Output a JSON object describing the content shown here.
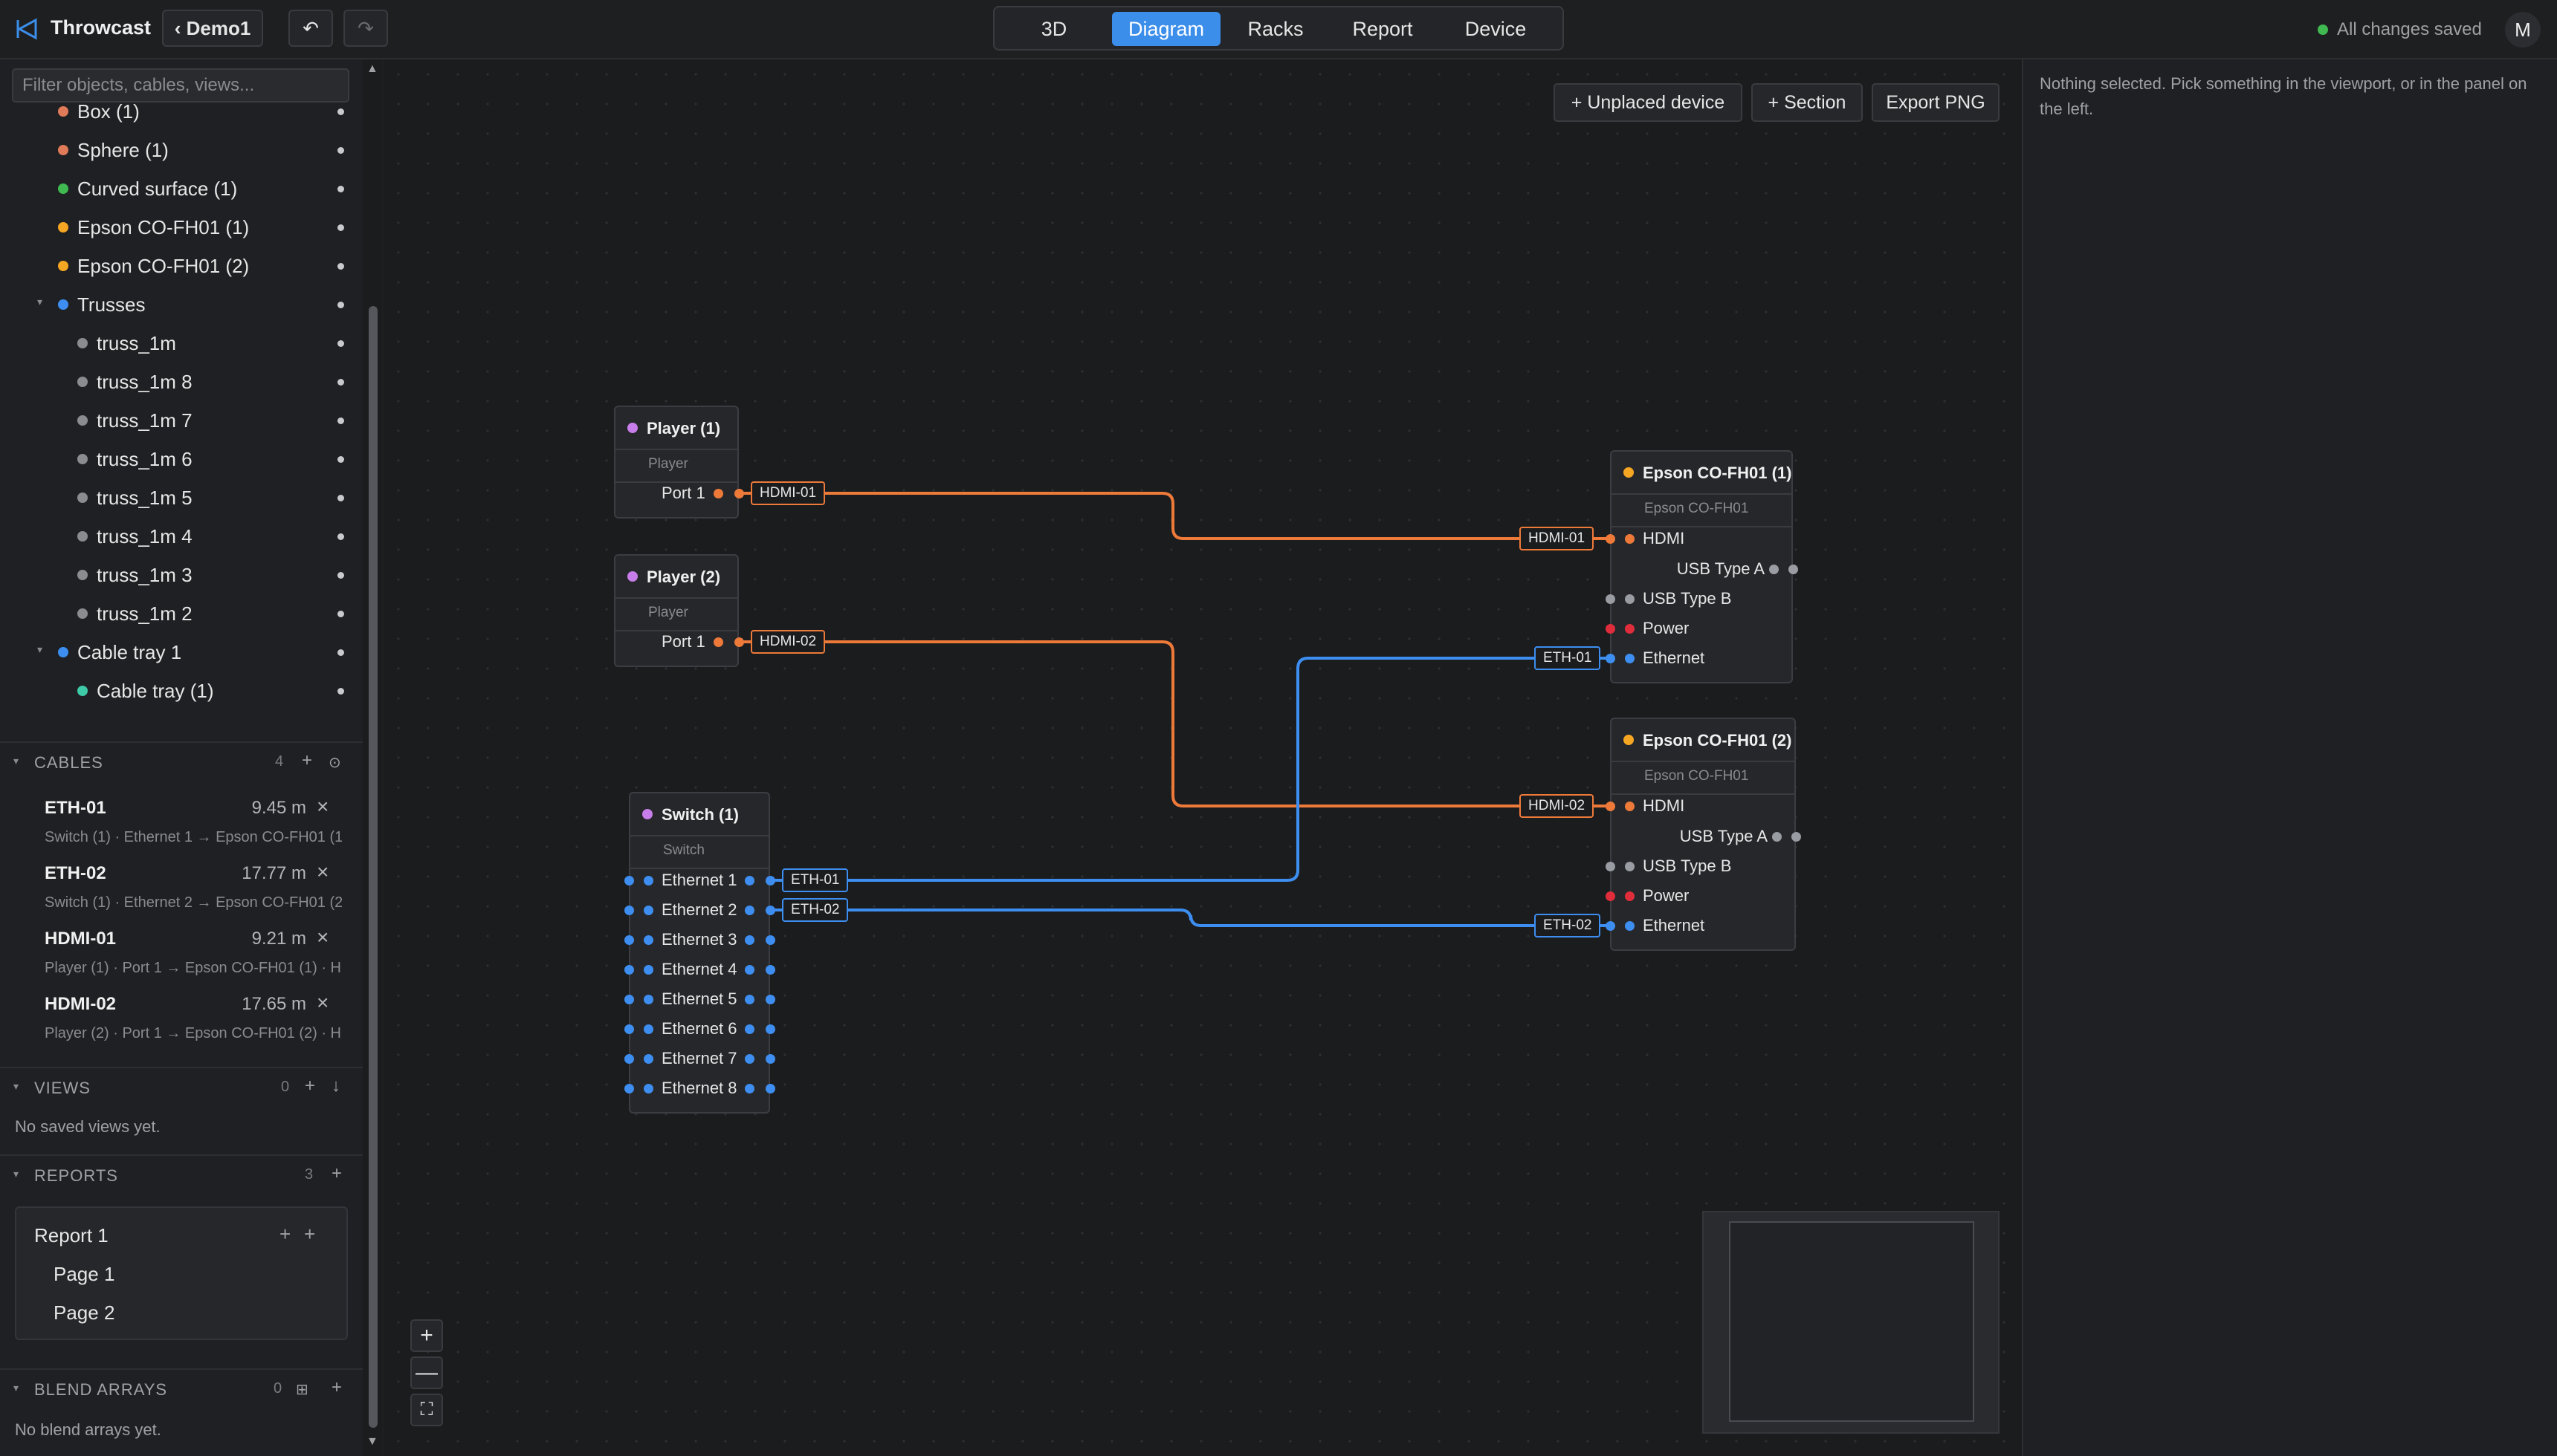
{
  "app": {
    "name": "Throwcast",
    "project_button": "‹ Demo1",
    "undo": "↶",
    "redo": "↷",
    "tabs": [
      {
        "label": "3D",
        "active": false
      },
      {
        "label": "Diagram",
        "active": true
      },
      {
        "label": "Racks",
        "active": false
      },
      {
        "label": "Report",
        "active": false
      },
      {
        "label": "Device",
        "active": false
      }
    ],
    "save_status": "All changes saved",
    "avatar_initial": "M",
    "colors": {
      "accent": "#3b8eea",
      "saved": "#3fb950",
      "hdmi": "#ee7a3a",
      "ethernet": "#3d8ef0",
      "power": "#e02d3c",
      "usb": "#9a9ca3"
    }
  },
  "sidebar": {
    "filter_placeholder": "Filter objects, cables, views...",
    "tree": [
      {
        "label": "Box (1)",
        "color": "#e07b5a",
        "indent": 1,
        "chevron": ""
      },
      {
        "label": "Sphere (1)",
        "color": "#e07b5a",
        "indent": 1,
        "chevron": ""
      },
      {
        "label": "Curved surface (1)",
        "color": "#3fb950",
        "indent": 1,
        "chevron": ""
      },
      {
        "label": "Epson CO-FH01 (1)",
        "color": "#f5a623",
        "indent": 1,
        "chevron": ""
      },
      {
        "label": "Epson CO-FH01 (2)",
        "color": "#f5a623",
        "indent": 1,
        "chevron": ""
      },
      {
        "label": "Trusses",
        "color": "#3d8ef0",
        "indent": 1,
        "chevron": "▾"
      },
      {
        "label": "truss_1m",
        "color": "#8b8c90",
        "indent": 2,
        "chevron": ""
      },
      {
        "label": "truss_1m 8",
        "color": "#8b8c90",
        "indent": 2,
        "chevron": ""
      },
      {
        "label": "truss_1m 7",
        "color": "#8b8c90",
        "indent": 2,
        "chevron": ""
      },
      {
        "label": "truss_1m 6",
        "color": "#8b8c90",
        "indent": 2,
        "chevron": ""
      },
      {
        "label": "truss_1m 5",
        "color": "#8b8c90",
        "indent": 2,
        "chevron": ""
      },
      {
        "label": "truss_1m 4",
        "color": "#8b8c90",
        "indent": 2,
        "chevron": ""
      },
      {
        "label": "truss_1m 3",
        "color": "#8b8c90",
        "indent": 2,
        "chevron": ""
      },
      {
        "label": "truss_1m 2",
        "color": "#8b8c90",
        "indent": 2,
        "chevron": ""
      },
      {
        "label": "Cable tray 1",
        "color": "#3d8ef0",
        "indent": 1,
        "chevron": "▾"
      },
      {
        "label": "Cable tray (1)",
        "color": "#3ec9a7",
        "indent": 2,
        "chevron": ""
      }
    ],
    "cables_section": {
      "title": "CABLES",
      "count": "4",
      "add": "+",
      "extra": "⊙"
    },
    "cables": [
      {
        "name": "ETH-01",
        "length": "9.45 m",
        "description": "Switch (1) · Ethernet 1 → Epson CO-FH01 (1..."
      },
      {
        "name": "ETH-02",
        "length": "17.77 m",
        "description": "Switch (1) · Ethernet 2 → Epson CO-FH01 (2..."
      },
      {
        "name": "HDMI-01",
        "length": "9.21 m",
        "description": "Player (1) · Port 1 → Epson CO-FH01 (1) · H..."
      },
      {
        "name": "HDMI-02",
        "length": "17.65 m",
        "description": "Player (2) · Port 1 → Epson CO-FH01 (2) · H..."
      }
    ],
    "views_section": {
      "title": "VIEWS",
      "count": "0",
      "add": "+",
      "extra": "↓",
      "empty": "No saved views yet."
    },
    "reports_section": {
      "title": "REPORTS",
      "count": "3",
      "add": "+"
    },
    "report": {
      "name": "Report 1",
      "actions": "++",
      "pages": [
        "Page 1",
        "Page 2"
      ]
    },
    "blend_section": {
      "title": "BLEND ARRAYS",
      "count": "0",
      "add": "+",
      "extra": "⊞",
      "empty": "No blend arrays yet."
    }
  },
  "canvas": {
    "buttons": {
      "unplaced": "+ Unplaced device",
      "section": "+ Section",
      "export": "Export PNG"
    },
    "zoom": {
      "in": "+",
      "out": "—",
      "fit": "⛶"
    },
    "nodes": [
      {
        "id": "player1",
        "title": "Player (1)",
        "type": "Player",
        "color": "#c77dea",
        "ports": [
          {
            "label": "Port 1",
            "kind": "hdmi",
            "side": "right"
          }
        ]
      },
      {
        "id": "player2",
        "title": "Player (2)",
        "type": "Player",
        "color": "#c77dea",
        "ports": [
          {
            "label": "Port 1",
            "kind": "hdmi",
            "side": "right"
          }
        ]
      },
      {
        "id": "switch1",
        "title": "Switch (1)",
        "type": "Switch",
        "color": "#c77dea",
        "ports": [
          {
            "label": "Ethernet 1",
            "kind": "ethernet",
            "side": "both"
          },
          {
            "label": "Ethernet 2",
            "kind": "ethernet",
            "side": "both"
          },
          {
            "label": "Ethernet 3",
            "kind": "ethernet",
            "side": "both"
          },
          {
            "label": "Ethernet 4",
            "kind": "ethernet",
            "side": "both"
          },
          {
            "label": "Ethernet 5",
            "kind": "ethernet",
            "side": "both"
          },
          {
            "label": "Ethernet 6",
            "kind": "ethernet",
            "side": "both"
          },
          {
            "label": "Ethernet 7",
            "kind": "ethernet",
            "side": "both"
          },
          {
            "label": "Ethernet 8",
            "kind": "ethernet",
            "side": "both"
          }
        ]
      },
      {
        "id": "epson1",
        "title": "Epson CO-FH01 (1)",
        "type": "Epson CO-FH01",
        "color": "#f5a623",
        "ports": [
          {
            "label": "HDMI",
            "kind": "hdmi",
            "side": "left"
          },
          {
            "label": "USB Type A",
            "kind": "usb",
            "side": "right"
          },
          {
            "label": "USB Type B",
            "kind": "usb",
            "side": "left"
          },
          {
            "label": "Power",
            "kind": "power",
            "side": "left"
          },
          {
            "label": "Ethernet",
            "kind": "ethernet",
            "side": "left"
          }
        ]
      },
      {
        "id": "epson2",
        "title": "Epson CO-FH01 (2)",
        "type": "Epson CO-FH01",
        "color": "#f5a623",
        "ports": [
          {
            "label": "HDMI",
            "kind": "hdmi",
            "side": "left"
          },
          {
            "label": "USB Type A",
            "kind": "usb",
            "side": "right"
          },
          {
            "label": "USB Type B",
            "kind": "usb",
            "side": "left"
          },
          {
            "label": "Power",
            "kind": "power",
            "side": "left"
          },
          {
            "label": "Ethernet",
            "kind": "ethernet",
            "side": "left"
          }
        ]
      }
    ],
    "connections": [
      {
        "name": "HDMI-01",
        "kind": "hdmi",
        "from": "player1.0",
        "to": "epson1.0"
      },
      {
        "name": "HDMI-02",
        "kind": "hdmi",
        "from": "player2.0",
        "to": "epson2.0"
      },
      {
        "name": "ETH-01",
        "kind": "ethernet",
        "from": "switch1.0",
        "to": "epson1.4"
      },
      {
        "name": "ETH-02",
        "kind": "ethernet",
        "from": "switch1.1",
        "to": "epson2.4"
      }
    ]
  },
  "inspector": {
    "message": "Nothing selected. Pick something in the viewport, or in the panel on the left."
  }
}
